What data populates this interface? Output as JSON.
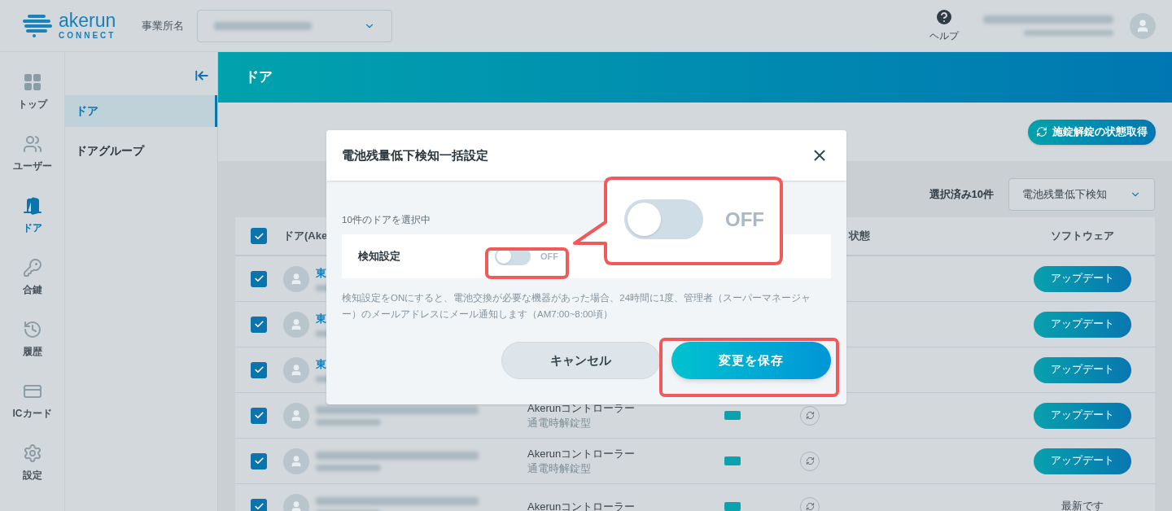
{
  "header": {
    "wordmark": "akerun",
    "wordmark_sub": "CONNECT",
    "office_label": "事業所名",
    "help_label": "ヘルプ"
  },
  "rail": [
    {
      "kind": "top",
      "label": "トップ",
      "selected": false
    },
    {
      "kind": "users",
      "label": "ユーザー",
      "selected": false
    },
    {
      "kind": "door",
      "label": "ドア",
      "selected": true
    },
    {
      "kind": "key",
      "label": "合鍵",
      "selected": false
    },
    {
      "kind": "history",
      "label": "履歴",
      "selected": false
    },
    {
      "kind": "card",
      "label": "ICカード",
      "selected": false
    },
    {
      "kind": "settings",
      "label": "設定",
      "selected": false
    }
  ],
  "subnav": [
    {
      "label": "ドア",
      "selected": true
    },
    {
      "label": "ドアグループ",
      "selected": false
    }
  ],
  "page_title": "ドア",
  "status_button": "施錠解錠の状態取得",
  "selection_count": "選択済み10件",
  "bulk_action": "電池残量低下検知",
  "table": {
    "header_checked": true,
    "columns": [
      "ドア(Ake",
      "状態",
      "ソフトウェア"
    ],
    "rows": [
      {
        "kind": "covered",
        "checked": true,
        "name": "東",
        "software": {
          "kind": "button",
          "label": "アップデート"
        }
      },
      {
        "kind": "covered",
        "checked": true,
        "name": "東",
        "software": {
          "kind": "button",
          "label": "アップデート"
        }
      },
      {
        "kind": "covered",
        "checked": true,
        "name": "東",
        "software": {
          "kind": "button",
          "label": "アップデート"
        }
      },
      {
        "kind": "full",
        "checked": true,
        "type": "Akerunコントローラー",
        "subtype": "通電時解錠型",
        "software": {
          "kind": "button",
          "label": "アップデート"
        }
      },
      {
        "kind": "full",
        "checked": true,
        "type": "Akerunコントローラー",
        "subtype": "通電時解錠型",
        "software": {
          "kind": "button",
          "label": "アップデート"
        }
      },
      {
        "kind": "full",
        "checked": true,
        "type": "Akerunコントローラー",
        "software": {
          "kind": "text",
          "label": "最新です"
        }
      }
    ]
  },
  "modal": {
    "title": "電池残量低下検知一括設定",
    "selected_info": "10件のドアを選択中",
    "setting_label": "検知設定",
    "toggle": {
      "on": false,
      "label": "OFF"
    },
    "description": "検知設定をONにすると、電池交換が必要な機器があった場合、24時間に1度、管理者（スーパーマネージャー）のメールアドレスにメール通知します（AM7:00~8:00頃）",
    "cancel": "キャンセル",
    "save": "変更を保存"
  },
  "callout": {
    "on": false,
    "label": "OFF"
  }
}
